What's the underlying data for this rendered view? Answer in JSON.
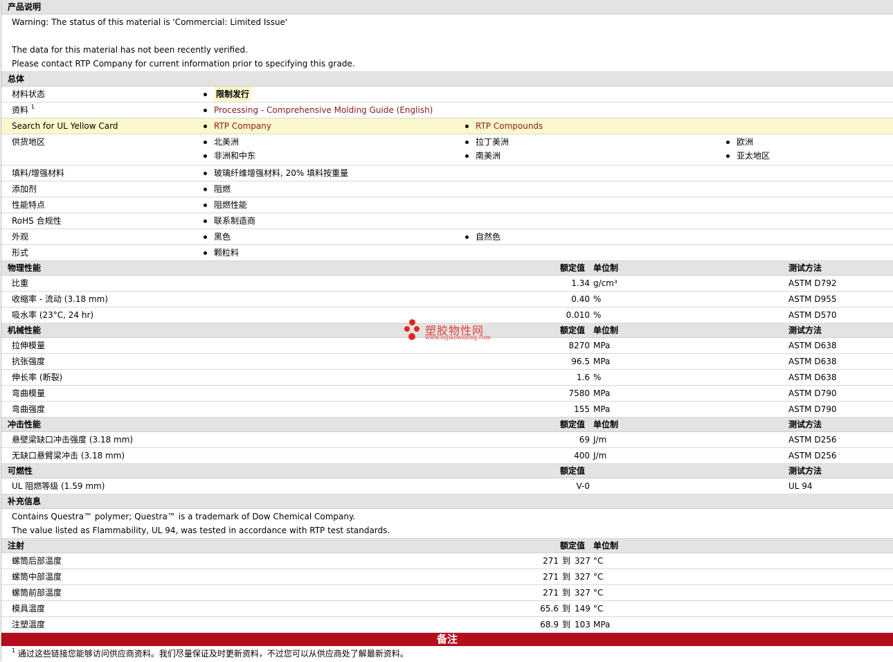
{
  "desc": {
    "title": "产品说明",
    "lines": [
      "Warning: The status of this material is 'Commercial: Limited Issue'",
      "",
      "The data for this material has not been recently verified.",
      "Please contact RTP Company for current information prior to specifying this grade."
    ]
  },
  "general": {
    "title": "总体",
    "status": {
      "label": "材料状态",
      "value": "限制发行"
    },
    "docs": {
      "label": "资料",
      "sup": "1",
      "value": "Processing - Comprehensive Molding Guide (English)"
    },
    "ul": {
      "label": "Search for UL Yellow Card",
      "v1": "RTP Company",
      "v2": "RTP Compounds"
    },
    "regions": {
      "label": "供货地区",
      "items": [
        "北美洲",
        "拉丁美洲",
        "欧洲",
        "非洲和中东",
        "南美洲",
        "亚太地区"
      ]
    },
    "filler": {
      "label": "填料/增强材料",
      "value": "玻璃纤维增强材料, 20% 填料按重量"
    },
    "additive": {
      "label": "添加剂",
      "value": "阻燃"
    },
    "features": {
      "label": "性能特点",
      "value": "阻燃性能"
    },
    "rohs": {
      "label": "RoHS 合规性",
      "value": "联系制造商"
    },
    "appearance": {
      "label": "外观",
      "v1": "黑色",
      "v2": "自然色"
    },
    "form": {
      "label": "形式",
      "value": "颗粒料"
    }
  },
  "headers": {
    "nominal": "额定值",
    "unit": "单位制",
    "method": "测试方法"
  },
  "physical": {
    "title": "物理性能",
    "rows": [
      {
        "label": "比重",
        "value": "1.34",
        "unit": "g/cm³",
        "method": "ASTM D792"
      },
      {
        "label": "收缩率  - 流动  (3.18 mm)",
        "value": "0.40",
        "unit": "%",
        "method": "ASTM D955"
      },
      {
        "label": "吸水率  (23°C, 24 hr)",
        "value": "0.010",
        "unit": "%",
        "method": "ASTM D570"
      }
    ]
  },
  "mechanical": {
    "title": "机械性能",
    "rows": [
      {
        "label": "拉伸模量",
        "value": "8270",
        "unit": "MPa",
        "method": "ASTM D638"
      },
      {
        "label": "抗张强度",
        "value": "96.5",
        "unit": "MPa",
        "method": "ASTM D638"
      },
      {
        "label": "伸长率  (断裂)",
        "value": "1.6",
        "unit": "%",
        "method": "ASTM D638"
      },
      {
        "label": "弯曲模量",
        "value": "7580",
        "unit": "MPa",
        "method": "ASTM D790"
      },
      {
        "label": "弯曲强度",
        "value": "155",
        "unit": "MPa",
        "method": "ASTM D790"
      }
    ]
  },
  "impact": {
    "title": "冲击性能",
    "rows": [
      {
        "label": "悬壁梁缺口冲击强度  (3.18 mm)",
        "value": "69",
        "unit": "J/m",
        "method": "ASTM D256"
      },
      {
        "label": "无缺口悬臂梁冲击  (3.18 mm)",
        "value": "400",
        "unit": "J/m",
        "method": "ASTM D256"
      }
    ]
  },
  "flammability": {
    "title": "可燃性",
    "rows": [
      {
        "label": "UL 阻燃等级  (1.59 mm)",
        "value": "V-0",
        "method": "UL 94"
      }
    ]
  },
  "supplemental": {
    "title": "补充信息",
    "lines": [
      "Contains Questra™ polymer; Questra™ is a trademark of Dow Chemical Company.",
      "The value listed as Flammability, UL 94, was tested in accordance with RTP test standards."
    ]
  },
  "injection": {
    "title": "注射",
    "to": "到",
    "rows": [
      {
        "label": "螺筒后部温度",
        "min": "271",
        "max": "327",
        "unit": "°C"
      },
      {
        "label": "螺筒中部温度",
        "min": "271",
        "max": "327",
        "unit": "°C"
      },
      {
        "label": "螺筒前部温度",
        "min": "271",
        "max": "327",
        "unit": "°C"
      },
      {
        "label": "模具温度",
        "min": "65.6",
        "max": "149",
        "unit": "°C"
      },
      {
        "label": "注塑温度",
        "min": "68.9",
        "max": "103",
        "unit": "MPa"
      }
    ]
  },
  "notes": {
    "title": "备注",
    "sup": "1",
    "text": "通过这些链接您能够访问供应商资料。我们尽量保证及时更新资料，不过您可以从供应商处了解最新资料。"
  },
  "watermark": {
    "name": "塑胶物性网",
    "url": "www.sujiaowuxing.com"
  }
}
